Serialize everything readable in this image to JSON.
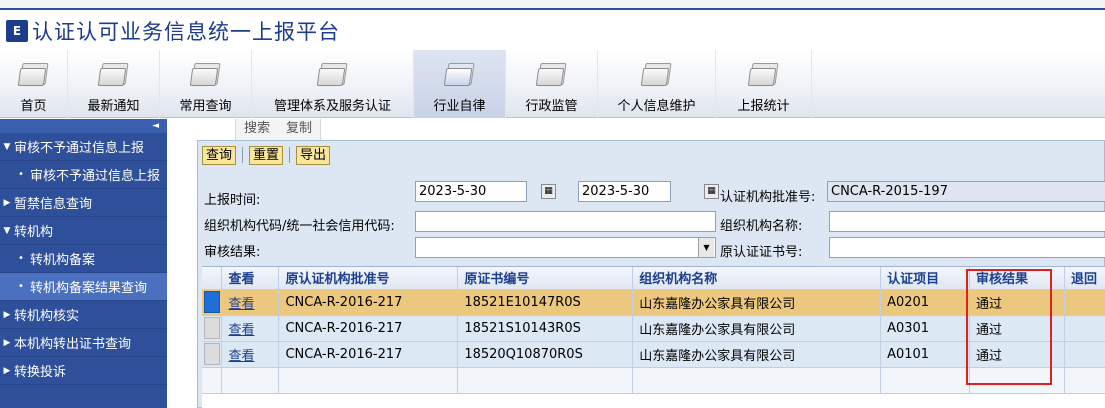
{
  "app": {
    "logo_text": "E",
    "title": "认证认可业务信息统一上报平台"
  },
  "nav": [
    {
      "label": "首页"
    },
    {
      "label": "最新通知"
    },
    {
      "label": "常用查询"
    },
    {
      "label": "管理体系及服务认证"
    },
    {
      "label": "行业自律"
    },
    {
      "label": "行政监管"
    },
    {
      "label": "个人信息维护"
    },
    {
      "label": "上报统计"
    }
  ],
  "sidebar": {
    "collapse": "◄",
    "items": [
      {
        "label": "审核不予通过信息上报"
      },
      {
        "label": "审核不予通过信息上报"
      },
      {
        "label": "暂禁信息查询"
      },
      {
        "label": "转机构"
      },
      {
        "label": "转机构备案"
      },
      {
        "label": "转机构备案结果查询"
      },
      {
        "label": "转机构核实"
      },
      {
        "label": "本机构转出证书查询"
      },
      {
        "label": "转换投诉"
      }
    ]
  },
  "subtabs": [
    {
      "label": "搜索"
    },
    {
      "label": "复制"
    }
  ],
  "toolbar": {
    "query": "查询",
    "reset": "重置",
    "export": "导出"
  },
  "form": {
    "report_time_label": "上报时间:",
    "date_from": "2023-5-30",
    "to_label": "至",
    "date_to": "2023-5-30",
    "approval_no_label": "认证机构批准号:",
    "approval_no": "CNCA-R-2015-197",
    "org_code_label": "组织机构代码/统一社会信用代码:",
    "org_code": "",
    "org_name_label": "组织机构名称:",
    "org_name": "",
    "review_result_label": "审核结果:",
    "review_result": "",
    "orig_cert_label": "原认证证书号:",
    "orig_cert": ""
  },
  "grid": {
    "columns": [
      "查看",
      "原认证机构批准号",
      "原证书编号",
      "组织机构名称",
      "认证项目",
      "审核结果",
      "退回"
    ],
    "rows": [
      {
        "view": "查看",
        "approval": "CNCA-R-2016-217",
        "cert": "18521E10147R0S",
        "org": "山东嘉隆办公家具有限公司",
        "project": "A0201",
        "result": "通过",
        "returned": ""
      },
      {
        "view": "查看",
        "approval": "CNCA-R-2016-217",
        "cert": "18521S10143R0S",
        "org": "山东嘉隆办公家具有限公司",
        "project": "A0301",
        "result": "通过",
        "returned": ""
      },
      {
        "view": "查看",
        "approval": "CNCA-R-2016-217",
        "cert": "18520Q10870R0S",
        "org": "山东嘉隆办公家具有限公司",
        "project": "A0101",
        "result": "通过",
        "returned": ""
      }
    ]
  },
  "colors": {
    "brand": "#1c3d8c",
    "sidebar": "#2e4f99",
    "highlight": "#e02020",
    "selected_row": "#ecc87e"
  }
}
